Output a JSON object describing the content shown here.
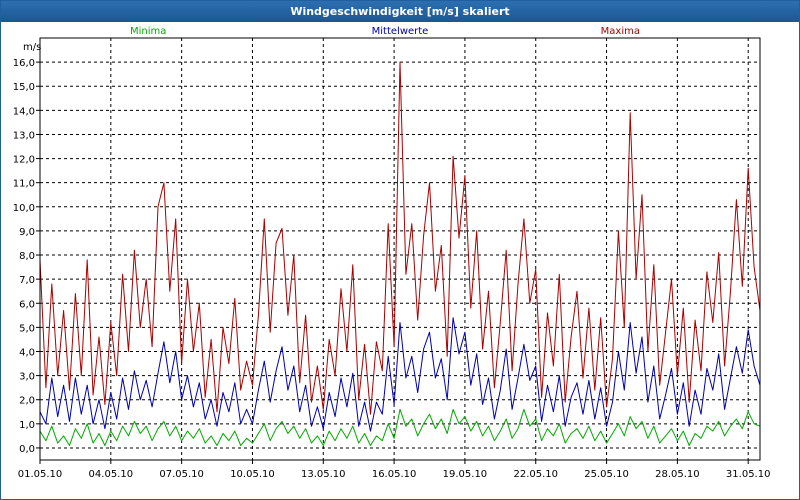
{
  "window": {
    "title": "Windgeschwindigkeit [m/s] skaliert"
  },
  "chart_data": {
    "type": "line",
    "ylabel": "m/s",
    "ylim": [
      -0.5,
      17.0
    ],
    "xlim": [
      0,
      30.5
    ],
    "yticks": [
      0,
      1,
      2,
      3,
      4,
      5,
      6,
      7,
      8,
      9,
      10,
      11,
      12,
      13,
      14,
      15,
      16
    ],
    "ytick_labels": [
      "0,0",
      "1,0",
      "2,0",
      "3,0",
      "4,0",
      "5,0",
      "6,0",
      "7,0",
      "8,0",
      "9,0",
      "10,0",
      "11,0",
      "12,0",
      "13,0",
      "14,0",
      "15,0",
      "16,0"
    ],
    "xticks": [
      0,
      3,
      6,
      9,
      12,
      15,
      18,
      21,
      24,
      27,
      30
    ],
    "xtick_labels": [
      "01.05.10",
      "04.05.10",
      "07.05.10",
      "10.05.10",
      "13.05.10",
      "16.05.10",
      "19.05.10",
      "22.05.10",
      "25.05.10",
      "28.05.10",
      "31.05.10"
    ],
    "grid": true,
    "legend_position": "top",
    "series": [
      {
        "name": "Minima",
        "color": "#00aa00",
        "x": [
          0,
          0.25,
          0.5,
          0.75,
          1,
          1.25,
          1.5,
          1.75,
          2,
          2.25,
          2.5,
          2.75,
          3,
          3.25,
          3.5,
          3.75,
          4,
          4.25,
          4.5,
          4.75,
          5,
          5.25,
          5.5,
          5.75,
          6,
          6.25,
          6.5,
          6.75,
          7,
          7.25,
          7.5,
          7.75,
          8,
          8.25,
          8.5,
          8.75,
          9,
          9.25,
          9.5,
          9.75,
          10,
          10.25,
          10.5,
          10.75,
          11,
          11.25,
          11.5,
          11.75,
          12,
          12.25,
          12.5,
          12.75,
          13,
          13.25,
          13.5,
          13.75,
          14,
          14.25,
          14.5,
          14.75,
          15,
          15.25,
          15.5,
          15.75,
          16,
          16.25,
          16.5,
          16.75,
          17,
          17.25,
          17.5,
          17.75,
          18,
          18.25,
          18.5,
          18.75,
          19,
          19.25,
          19.5,
          19.75,
          20,
          20.25,
          20.5,
          20.75,
          21,
          21.25,
          21.5,
          21.75,
          22,
          22.25,
          22.5,
          22.75,
          23,
          23.25,
          23.5,
          23.75,
          24,
          24.25,
          24.5,
          24.75,
          25,
          25.25,
          25.5,
          25.75,
          26,
          26.25,
          26.5,
          26.75,
          27,
          27.25,
          27.5,
          27.75,
          28,
          28.25,
          28.5,
          28.75,
          29,
          29.25,
          29.5,
          29.75,
          30,
          30.25,
          30.5
        ],
        "values": [
          0.7,
          0.3,
          0.9,
          0.2,
          0.5,
          0.1,
          0.8,
          0.4,
          1.0,
          0.2,
          0.6,
          0.1,
          0.7,
          0.3,
          0.9,
          0.5,
          1.1,
          0.6,
          0.9,
          0.3,
          0.8,
          1.1,
          0.5,
          0.9,
          0.3,
          0.7,
          0.4,
          0.8,
          0.2,
          0.5,
          0.1,
          0.6,
          0.3,
          0.7,
          0.1,
          0.4,
          0.2,
          0.6,
          1.0,
          0.3,
          0.8,
          1.1,
          0.6,
          0.9,
          0.4,
          0.8,
          0.2,
          0.5,
          0.1,
          0.7,
          0.3,
          0.8,
          0.4,
          0.9,
          0.2,
          0.6,
          0.1,
          0.5,
          0.3,
          1.0,
          0.4,
          1.6,
          0.9,
          1.2,
          0.5,
          1.0,
          1.4,
          0.8,
          1.2,
          0.6,
          1.6,
          1.0,
          1.3,
          0.7,
          1.1,
          0.5,
          0.9,
          0.3,
          0.7,
          1.2,
          0.4,
          0.8,
          1.6,
          0.9,
          1.2,
          0.3,
          0.8,
          0.5,
          1.0,
          0.2,
          0.6,
          0.8,
          0.4,
          0.9,
          0.3,
          0.7,
          0.2,
          0.6,
          1.0,
          0.5,
          1.3,
          0.8,
          1.1,
          0.4,
          0.9,
          0.2,
          0.5,
          0.8,
          0.3,
          0.7,
          0.1,
          0.6,
          0.4,
          0.9,
          0.7,
          1.1,
          0.5,
          0.9,
          1.2,
          0.8,
          1.5,
          1.0,
          0.9
        ]
      },
      {
        "name": "Mittelwerte",
        "color": "#0000aa",
        "x": [
          0,
          0.25,
          0.5,
          0.75,
          1,
          1.25,
          1.5,
          1.75,
          2,
          2.25,
          2.5,
          2.75,
          3,
          3.25,
          3.5,
          3.75,
          4,
          4.25,
          4.5,
          4.75,
          5,
          5.25,
          5.5,
          5.75,
          6,
          6.25,
          6.5,
          6.75,
          7,
          7.25,
          7.5,
          7.75,
          8,
          8.25,
          8.5,
          8.75,
          9,
          9.25,
          9.5,
          9.75,
          10,
          10.25,
          10.5,
          10.75,
          11,
          11.25,
          11.5,
          11.75,
          12,
          12.25,
          12.5,
          12.75,
          13,
          13.25,
          13.5,
          13.75,
          14,
          14.25,
          14.5,
          14.75,
          15,
          15.25,
          15.5,
          15.75,
          16,
          16.25,
          16.5,
          16.75,
          17,
          17.25,
          17.5,
          17.75,
          18,
          18.25,
          18.5,
          18.75,
          19,
          19.25,
          19.5,
          19.75,
          20,
          20.25,
          20.5,
          20.75,
          21,
          21.25,
          21.5,
          21.75,
          22,
          22.25,
          22.5,
          22.75,
          23,
          23.25,
          23.5,
          23.75,
          24,
          24.25,
          24.5,
          24.75,
          25,
          25.25,
          25.5,
          25.75,
          26,
          26.25,
          26.5,
          26.75,
          27,
          27.25,
          27.5,
          27.75,
          28,
          28.25,
          28.5,
          28.75,
          29,
          29.25,
          29.5,
          29.75,
          30,
          30.25,
          30.5
        ],
        "values": [
          1.5,
          1.0,
          2.9,
          1.3,
          2.6,
          1.1,
          2.9,
          1.4,
          2.6,
          1.0,
          2.0,
          0.8,
          2.3,
          1.2,
          2.9,
          1.6,
          3.2,
          2.0,
          2.8,
          1.7,
          3.1,
          4.4,
          2.7,
          4.0,
          2.0,
          3.0,
          1.7,
          2.7,
          1.2,
          2.0,
          0.9,
          2.3,
          1.5,
          2.7,
          1.0,
          1.6,
          1.0,
          2.4,
          3.6,
          1.9,
          3.2,
          4.2,
          2.4,
          3.4,
          1.5,
          2.6,
          0.9,
          1.7,
          0.8,
          2.3,
          1.3,
          2.9,
          1.7,
          3.1,
          0.9,
          1.9,
          0.7,
          1.9,
          1.4,
          3.8,
          1.8,
          5.2,
          2.9,
          3.8,
          2.3,
          4.1,
          4.8,
          2.9,
          3.7,
          2.0,
          5.4,
          3.9,
          4.8,
          2.6,
          3.9,
          1.8,
          2.9,
          1.2,
          2.4,
          4.1,
          1.6,
          2.9,
          4.3,
          2.8,
          3.4,
          1.1,
          2.6,
          1.5,
          3.0,
          0.9,
          2.1,
          2.7,
          1.4,
          2.8,
          1.2,
          2.5,
          0.9,
          1.9,
          4.0,
          2.4,
          5.2,
          3.1,
          4.6,
          1.9,
          3.4,
          1.2,
          2.2,
          3.3,
          1.4,
          2.7,
          0.9,
          2.4,
          1.4,
          3.3,
          2.4,
          3.9,
          1.6,
          2.9,
          4.2,
          3.1,
          4.9,
          3.4,
          2.6
        ]
      },
      {
        "name": "Maxima",
        "color": "#aa0000",
        "x": [
          0,
          0.25,
          0.5,
          0.75,
          1,
          1.25,
          1.5,
          1.75,
          2,
          2.25,
          2.5,
          2.75,
          3,
          3.25,
          3.5,
          3.75,
          4,
          4.25,
          4.5,
          4.75,
          5,
          5.25,
          5.5,
          5.75,
          6,
          6.25,
          6.5,
          6.75,
          7,
          7.25,
          7.5,
          7.75,
          8,
          8.25,
          8.5,
          8.75,
          9,
          9.25,
          9.5,
          9.75,
          10,
          10.25,
          10.5,
          10.75,
          11,
          11.25,
          11.5,
          11.75,
          12,
          12.25,
          12.5,
          12.75,
          13,
          13.25,
          13.5,
          13.75,
          14,
          14.25,
          14.5,
          14.75,
          15,
          15.25,
          15.5,
          15.75,
          16,
          16.25,
          16.5,
          16.75,
          17,
          17.25,
          17.5,
          17.75,
          18,
          18.25,
          18.5,
          18.75,
          19,
          19.25,
          19.5,
          19.75,
          20,
          20.25,
          20.5,
          20.75,
          21,
          21.25,
          21.5,
          21.75,
          22,
          22.25,
          22.5,
          22.75,
          23,
          23.25,
          23.5,
          23.75,
          24,
          24.25,
          24.5,
          24.75,
          25,
          25.25,
          25.5,
          25.75,
          26,
          26.25,
          26.5,
          26.75,
          27,
          27.25,
          27.5,
          27.75,
          28,
          28.25,
          28.5,
          28.75,
          29,
          29.25,
          29.5,
          29.75,
          30,
          30.25,
          30.5
        ],
        "values": [
          7.8,
          2.5,
          6.8,
          3.0,
          5.7,
          2.4,
          6.4,
          3.0,
          7.8,
          2.2,
          4.6,
          1.8,
          5.2,
          3.0,
          7.2,
          4.0,
          8.2,
          5.0,
          7.0,
          4.2,
          10.0,
          11.0,
          6.5,
          9.5,
          3.5,
          7.0,
          4.0,
          6.0,
          2.1,
          4.5,
          1.5,
          5.0,
          3.5,
          6.2,
          2.4,
          3.6,
          2.6,
          5.5,
          9.5,
          4.8,
          8.5,
          9.1,
          5.5,
          8.0,
          2.7,
          5.5,
          1.9,
          3.4,
          1.6,
          4.5,
          3.0,
          6.6,
          4.0,
          7.6,
          2.0,
          4.3,
          1.4,
          4.4,
          3.2,
          9.3,
          4.2,
          16.0,
          7.2,
          9.3,
          5.3,
          8.8,
          11.0,
          6.5,
          8.4,
          3.8,
          12.1,
          8.7,
          11.3,
          5.8,
          9.0,
          4.1,
          6.5,
          2.5,
          5.2,
          8.2,
          3.2,
          6.8,
          9.5,
          6.0,
          7.4,
          2.1,
          5.6,
          3.4,
          7.2,
          1.9,
          4.6,
          6.5,
          2.9,
          5.8,
          2.4,
          5.4,
          1.7,
          3.7,
          9.0,
          5.0,
          13.9,
          7.0,
          10.5,
          4.0,
          7.6,
          2.6,
          4.8,
          7.0,
          3.0,
          5.8,
          1.9,
          5.3,
          3.2,
          7.3,
          5.2,
          8.1,
          3.4,
          6.5,
          10.3,
          6.7,
          11.6,
          7.5,
          5.7
        ]
      }
    ]
  }
}
